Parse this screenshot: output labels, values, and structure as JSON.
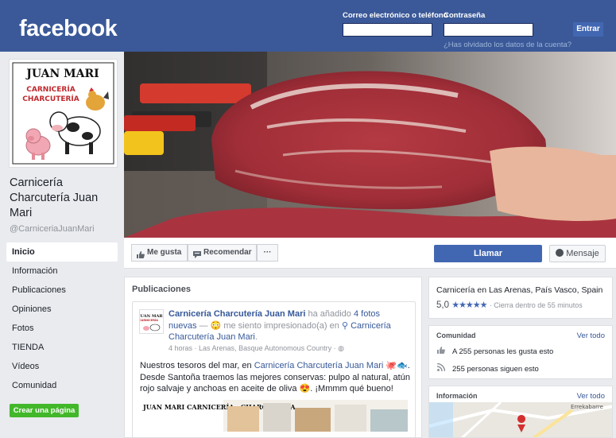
{
  "header": {
    "logo": "facebook",
    "email_label": "Correo electrónico o teléfono",
    "email_value": "",
    "password_label": "Contraseña",
    "password_value": "",
    "forgot_link": "¿Has olvidado los datos de la cuenta?",
    "login_button": "Entrar",
    "brand_color": "#3b5998"
  },
  "profile": {
    "logo_title": "JUAN MARI",
    "logo_line1": "CARNICERÍA",
    "logo_line2": "CHARCUTERÍA",
    "name": "Carnicería Charcutería Juan Mari",
    "handle": "@CarniceriaJuanMari"
  },
  "nav": {
    "items": [
      "Inicio",
      "Información",
      "Publicaciones",
      "Opiniones",
      "Fotos",
      "TIENDA",
      "Vídeos",
      "Comunidad"
    ],
    "active": "Inicio",
    "create_page": "Crear una página"
  },
  "actions": {
    "like": "Me gusta",
    "recommend": "Recomendar",
    "more": "···",
    "call": "Llamar",
    "message": "Mensaje",
    "call_color": "#4267b2"
  },
  "posts": {
    "title": "Publicaciones",
    "post": {
      "author": "Carnicería Charcutería Juan Mari",
      "action_prefix": " ha añadido ",
      "photo_count": "4 fotos nuevas",
      "feeling": " — 😳 me siento impresionado(a) en ",
      "location": "Carnicería Charcutería Juan Mari",
      "location_suffix": ".",
      "time": "4 horas",
      "place": "Las Arenas, Basque Autonomous Country",
      "text_prefix": "Nuestros tesoros del mar, en ",
      "text_link": "Carnicería Charcutería Juan Mari",
      "text_emojis": " 🐙🐟.",
      "text_body": "Desde Santoña traemos las mejores conservas: pulpo al natural, atún rojo salvaje y anchoas en aceite de oliva 😍. ¡Mmmm qué bueno!",
      "image_banner": "JUAN MARI  CARNICERÍA · CHARCUTERÍA"
    }
  },
  "right": {
    "category": "Carnicería en Las Arenas, País Vasco, Spain",
    "rating": "5,0",
    "stars": "★★★★★",
    "status": "· Cierra dentro de 55 minutos",
    "community_title": "Comunidad",
    "community_link": "Ver todo",
    "likes": "A 255 personas les gusta esto",
    "follows": "255 personas siguen esto",
    "info_title": "Información",
    "info_link": "Ver todo",
    "map_label": "Errekabarre"
  }
}
